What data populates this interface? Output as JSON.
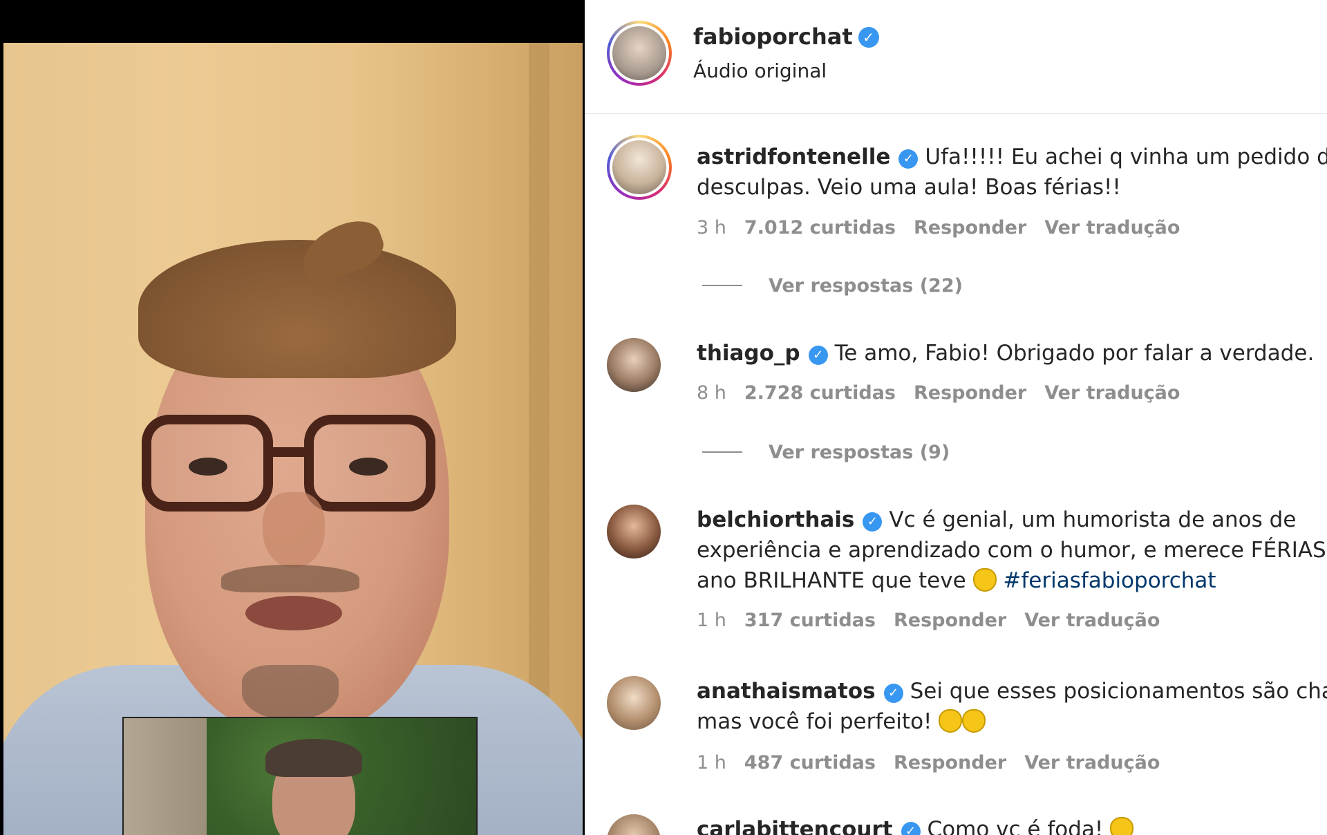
{
  "header": {
    "username": "fabioporchat",
    "subtitle": "Áudio original",
    "verified_symbol": "✓"
  },
  "comments": [
    {
      "username": "astridfontenelle",
      "lines": [
        "Ufa!!!!! Eu achei q vinha um pedido de",
        "desculpas. Veio uma aula! Boas férias!!"
      ],
      "time": "3 h",
      "likes": "7.012 curtidas",
      "reply": "Responder",
      "translate": "Ver tradução",
      "replies": "Ver respostas (22)"
    },
    {
      "username": "thiago_p",
      "lines": [
        "Te amo, Fabio! Obrigado por falar a verdade."
      ],
      "time": "8 h",
      "likes": "2.728 curtidas",
      "reply": "Responder",
      "translate": "Ver tradução",
      "replies": "Ver respostas (9)"
    },
    {
      "username": "belchiorthais",
      "lines": [
        "Vc é genial, um humorista de anos de",
        "experiência e aprendizado com o humor, e merece FÉRIAS pe",
        "ano BRILHANTE que teve"
      ],
      "hashtag": "#feriasfabioporchat",
      "time": "1 h",
      "likes": "317 curtidas",
      "reply": "Responder",
      "translate": "Ver tradução"
    },
    {
      "username": "anathaismatos",
      "lines": [
        "Sei que esses posicionamentos são chatos,",
        "mas você foi perfeito!"
      ],
      "time": "1 h",
      "likes": "487 curtidas",
      "reply": "Responder",
      "translate": "Ver tradução"
    },
    {
      "username": "carlabittencourt",
      "lines": [
        "Como vc é foda!"
      ]
    }
  ],
  "colors": {
    "verified": "#3897f0",
    "meta_gray": "#8e8e8e",
    "hashtag": "#00376b"
  },
  "icons": [
    "verified-badge-icon",
    "clapping-hands-emoji"
  ]
}
